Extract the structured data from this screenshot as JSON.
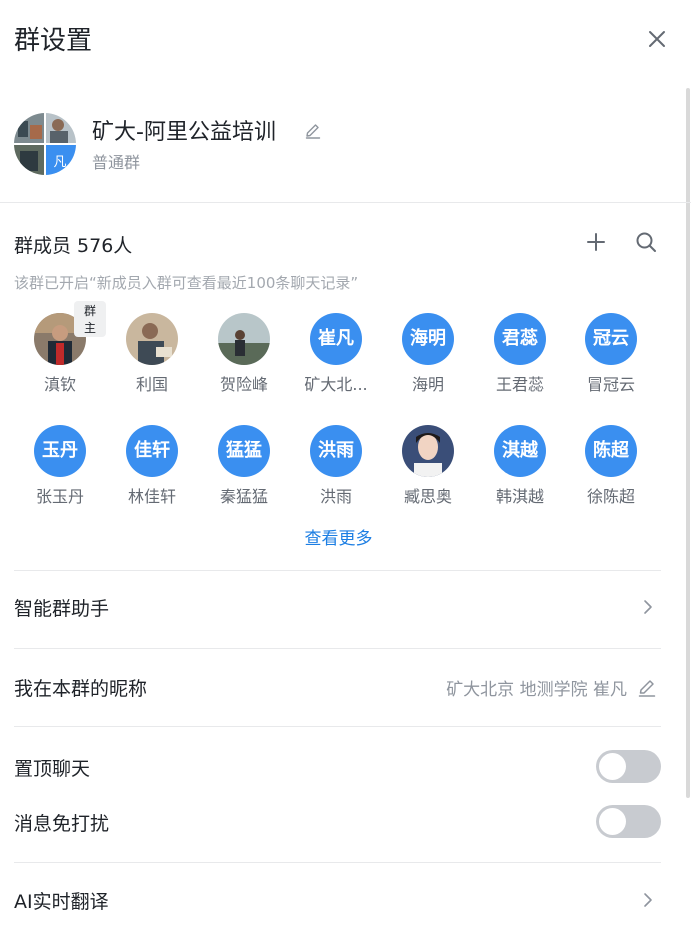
{
  "header": {
    "title": "群设置"
  },
  "group": {
    "name": "矿大-阿里公益培训",
    "type": "普通群",
    "avatar_initial": "凡"
  },
  "members": {
    "title": "群成员 576人",
    "notice": "该群已开启“新成员入群可查看最近100条聊天记录”",
    "owner_badge": "群主",
    "list": [
      {
        "name": "滇钦",
        "avatar_text": "",
        "photo": true
      },
      {
        "name": "利国",
        "avatar_text": "",
        "photo": true
      },
      {
        "name": "贺险峰",
        "avatar_text": "",
        "photo": true
      },
      {
        "name": "矿大北...",
        "avatar_text": "崔凡",
        "photo": false
      },
      {
        "name": "海明",
        "avatar_text": "海明",
        "photo": false
      },
      {
        "name": "王君蕊",
        "avatar_text": "君蕊",
        "photo": false
      },
      {
        "name": "冒冠云",
        "avatar_text": "冠云",
        "photo": false
      },
      {
        "name": "张玉丹",
        "avatar_text": "玉丹",
        "photo": false
      },
      {
        "name": "林佳轩",
        "avatar_text": "佳轩",
        "photo": false
      },
      {
        "name": "秦猛猛",
        "avatar_text": "猛猛",
        "photo": false
      },
      {
        "name": "洪雨",
        "avatar_text": "洪雨",
        "photo": false
      },
      {
        "name": "臧思奥",
        "avatar_text": "",
        "photo": true
      },
      {
        "name": "韩淇越",
        "avatar_text": "淇越",
        "photo": false
      },
      {
        "name": "徐陈超",
        "avatar_text": "陈超",
        "photo": false
      }
    ],
    "view_more": "查看更多"
  },
  "settings": {
    "assistant": "智能群助手",
    "nickname_label": "我在本群的昵称",
    "nickname_value": "矿大北京 地测学院 崔凡",
    "pin_chat": "置顶聊天",
    "pin_chat_on": false,
    "mute": "消息免打扰",
    "mute_on": false,
    "ai_translate": "AI实时翻译"
  },
  "colors": {
    "accent": "#3a8ff0",
    "link": "#1c7ee3",
    "toggle_off": "#c8cbd0"
  },
  "icons": [
    "close-icon",
    "edit-icon",
    "add-icon",
    "search-icon",
    "chevron-right-icon"
  ]
}
